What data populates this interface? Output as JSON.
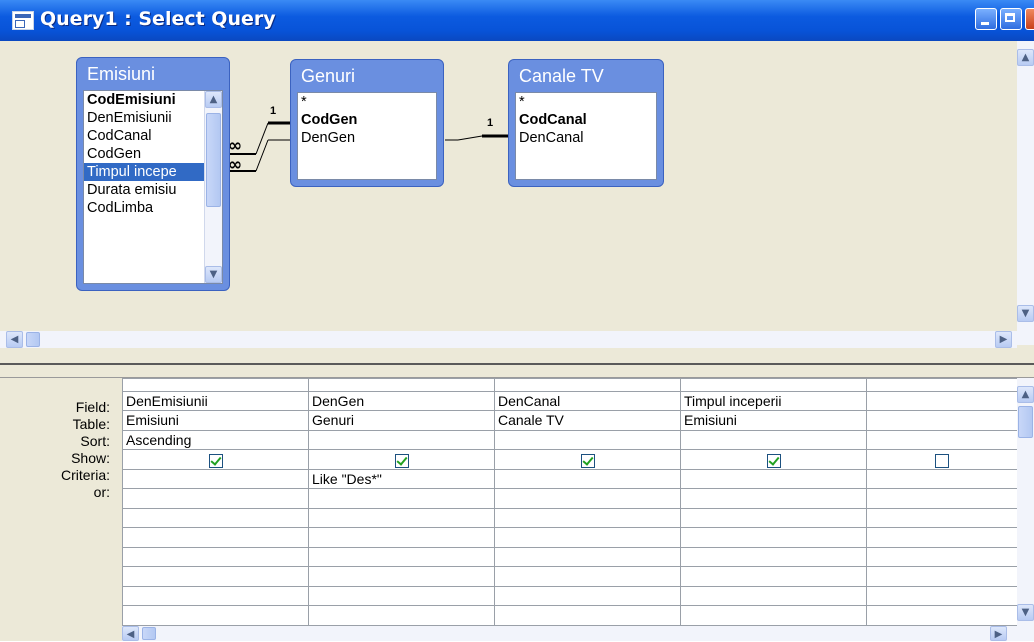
{
  "window": {
    "title": "Query1 : Select Query"
  },
  "tables": [
    {
      "name": "Emisiuni",
      "fields": [
        "CodEmisiuni",
        "DenEmisiunii",
        "CodCanal",
        "CodGen",
        "Timpul incepe",
        "Durata emisiu",
        "CodLimba"
      ],
      "key_fields": [
        "CodEmisiuni"
      ],
      "selected_field": "Timpul incepe"
    },
    {
      "name": "Genuri",
      "fields": [
        "*",
        "CodGen",
        "DenGen"
      ],
      "key_fields": [
        "CodGen"
      ]
    },
    {
      "name": "Canale TV",
      "fields": [
        "*",
        "CodCanal",
        "DenCanal"
      ],
      "key_fields": [
        "CodCanal"
      ]
    }
  ],
  "joins": [
    {
      "from_side": "∞",
      "to_side": "1"
    },
    {
      "from_side": "∞",
      "to_side": "1"
    }
  ],
  "grid": {
    "row_labels": [
      "Field:",
      "Table:",
      "Sort:",
      "Show:",
      "Criteria:",
      "or:"
    ],
    "columns": [
      {
        "field": "DenEmisiunii",
        "table": "Emisiuni",
        "sort": "Ascending",
        "show": true,
        "criteria": "",
        "or": ""
      },
      {
        "field": "DenGen",
        "table": "Genuri",
        "sort": "",
        "show": true,
        "criteria": "Like \"Des*\"",
        "or": ""
      },
      {
        "field": "DenCanal",
        "table": "Canale TV",
        "sort": "",
        "show": true,
        "criteria": "",
        "or": ""
      },
      {
        "field": "Timpul inceperii",
        "table": "Emisiuni",
        "sort": "",
        "show": true,
        "criteria": "",
        "or": ""
      },
      {
        "field": "",
        "table": "",
        "sort": "",
        "show": false,
        "criteria": "",
        "or": ""
      }
    ]
  }
}
